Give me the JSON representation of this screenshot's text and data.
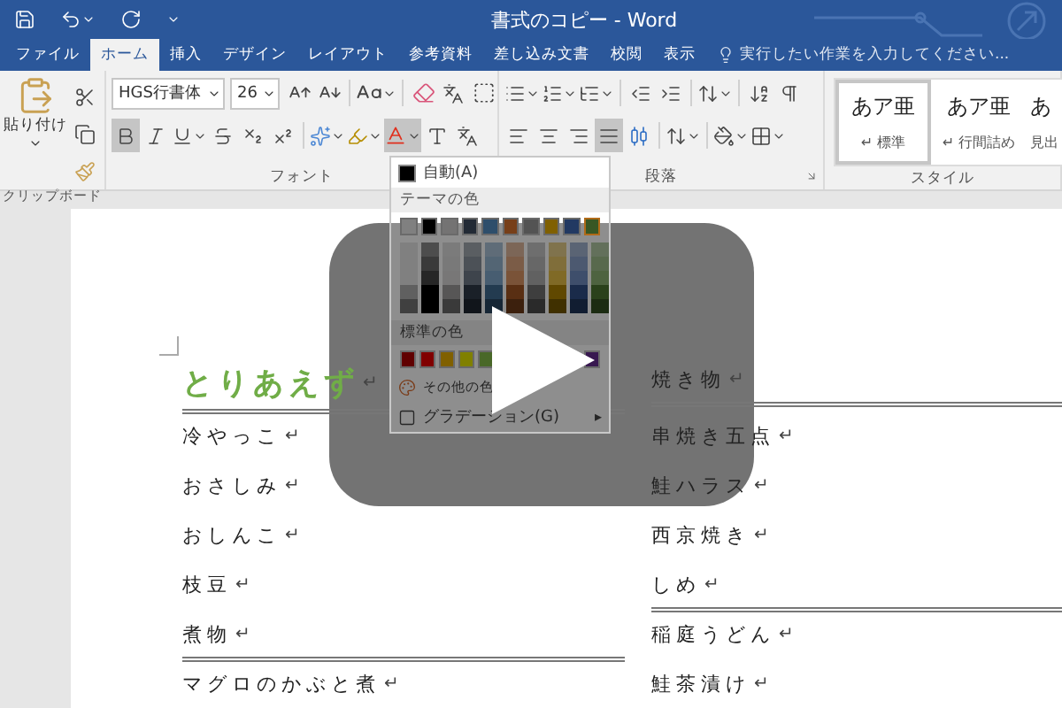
{
  "title_bar": {
    "title": "書式のコピー - Word"
  },
  "tabs": [
    {
      "label": "ファイル",
      "selected": false
    },
    {
      "label": "ホーム",
      "selected": true
    },
    {
      "label": "挿入",
      "selected": false
    },
    {
      "label": "デザイン",
      "selected": false
    },
    {
      "label": "レイアウト",
      "selected": false
    },
    {
      "label": "参考資料",
      "selected": false
    },
    {
      "label": "差し込み文書",
      "selected": false
    },
    {
      "label": "校閲",
      "selected": false
    },
    {
      "label": "表示",
      "selected": false
    }
  ],
  "tell_me": {
    "placeholder": "実行したい作業を入力してください..."
  },
  "ribbon": {
    "clipboard": {
      "paste_label": "貼り付け",
      "group_label": "クリップボード"
    },
    "font": {
      "font_name": "HGS行書体",
      "font_size": "26",
      "bold": true,
      "color_menu_open": true,
      "group_label": "フォント"
    },
    "paragraph": {
      "align_buttons": [
        {
          "selected": false
        },
        {
          "selected": false
        },
        {
          "selected": false
        },
        {
          "selected": true
        }
      ],
      "group_label": "段落"
    },
    "styles": {
      "items": [
        {
          "preview": "あア亜",
          "label": "↵ 標準",
          "selected": true
        },
        {
          "preview": "あア亜",
          "label": "↵ 行間詰め",
          "selected": false
        },
        {
          "preview": "あ",
          "label": "見出",
          "selected": false
        }
      ],
      "group_label": "スタイル"
    }
  },
  "color_menu": {
    "automatic": "自動(A)",
    "theme_header": "テーマの色",
    "theme_colors": [
      {
        "color": "#808080",
        "selected": false
      },
      {
        "color": "#000000",
        "selected": false
      },
      {
        "color": "#747373",
        "selected": false
      },
      {
        "color": "#222a35",
        "selected": false
      },
      {
        "color": "#2e4e6b",
        "selected": false
      },
      {
        "color": "#773f19",
        "selected": false
      },
      {
        "color": "#535353",
        "selected": false
      },
      {
        "color": "#806000",
        "selected": false
      },
      {
        "color": "#223962",
        "selected": false
      },
      {
        "color": "#385724",
        "selected": true
      }
    ],
    "standard_header": "標準の色",
    "standard_colors": [
      {
        "color": "#600000"
      },
      {
        "color": "#800000"
      },
      {
        "color": "#806000"
      },
      {
        "color": "#808000"
      },
      {
        "color": "#496828"
      },
      {
        "color": "#381850"
      }
    ],
    "more_colors": "その他の色",
    "gradient": "グラデーション(G)",
    "submenu_arrow": "▸"
  },
  "document": {
    "rows": [
      {
        "left": {
          "text": "とりあえず",
          "mark": "↵",
          "kind": "heading",
          "rule_below": true
        },
        "right": {
          "text": "焼き物",
          "mark": "↵",
          "kind": "item",
          "rule_below": true
        }
      },
      {
        "left": {
          "text": "冷やっこ",
          "mark": "↵",
          "kind": "item",
          "rule_below": false
        },
        "right": {
          "text": "串焼き五点",
          "mark": "↵",
          "kind": "item",
          "rule_below": false
        }
      },
      {
        "left": {
          "text": "おさしみ",
          "mark": "↵",
          "kind": "item",
          "rule_below": false
        },
        "right": {
          "text": "鮭ハラス",
          "mark": "↵",
          "kind": "item",
          "rule_below": false
        }
      },
      {
        "left": {
          "text": "おしんこ",
          "mark": "↵",
          "kind": "item",
          "rule_below": false
        },
        "right": {
          "text": "西京焼き",
          "mark": "↵",
          "kind": "item",
          "rule_below": false
        }
      },
      {
        "left": {
          "text": "枝豆",
          "mark": "↵",
          "kind": "item",
          "rule_below": false
        },
        "right": {
          "text": "しめ",
          "mark": "↵",
          "kind": "item",
          "rule_below": true
        }
      },
      {
        "left": {
          "text": "煮物",
          "mark": "↵",
          "kind": "item",
          "rule_below": true
        },
        "right": {
          "text": "稲庭うどん",
          "mark": "↵",
          "kind": "item",
          "rule_below": false
        }
      },
      {
        "left": {
          "text": "マグロのかぶと煮",
          "mark": "↵",
          "kind": "item",
          "rule_below": false
        },
        "right": {
          "text": "鮭茶漬け",
          "mark": "↵",
          "kind": "item",
          "rule_below": false
        }
      }
    ]
  }
}
